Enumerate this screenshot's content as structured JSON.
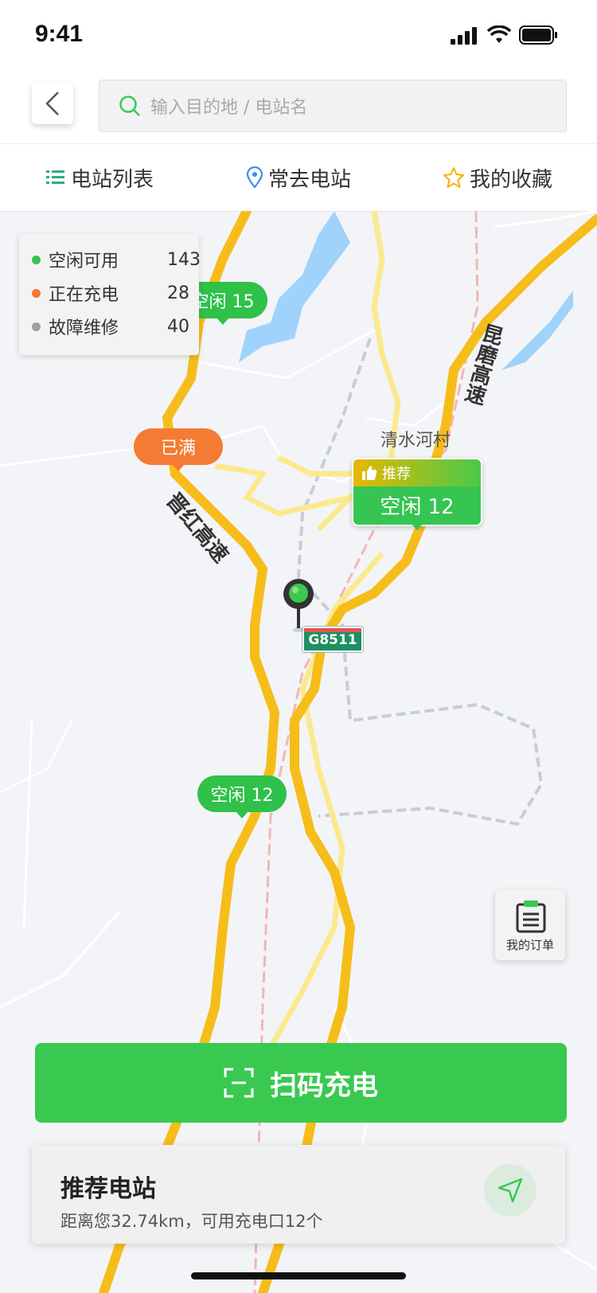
{
  "status_bar": {
    "time": "9:41"
  },
  "search": {
    "placeholder": "输入目的地 / 电站名"
  },
  "tabs": [
    {
      "label": "电站列表",
      "icon": "list-icon"
    },
    {
      "label": "常去电站",
      "icon": "location-pin-icon"
    },
    {
      "label": "我的收藏",
      "icon": "star-icon"
    }
  ],
  "legend": [
    {
      "label": "空闲可用",
      "count": "143",
      "color": "#36c452"
    },
    {
      "label": "正在充电",
      "count": "28",
      "color": "#f47b33"
    },
    {
      "label": "故障维修",
      "count": "40",
      "color": "#a0a0a0"
    }
  ],
  "map": {
    "bubbles": {
      "idle_15": "空闲 15",
      "full": "已满",
      "idle_12_b": "空闲 12"
    },
    "recommend": {
      "tag": "推荐",
      "value": "空闲 12"
    },
    "road_labels": {
      "jinhong": "晋红高速",
      "kunmo": "昆磨高速",
      "village": "清水河村",
      "highway_shield": "G8511"
    }
  },
  "orders": {
    "label": "我的订单"
  },
  "scan_button": {
    "label": "扫码充电"
  },
  "recommended_station": {
    "title": "推荐电站",
    "description": "距离您32.74km，可用充电口12个"
  },
  "colors": {
    "primary": "#39c950",
    "busy": "#f47b33",
    "fault": "#a0a0a0",
    "road": "#f5bd1f"
  }
}
